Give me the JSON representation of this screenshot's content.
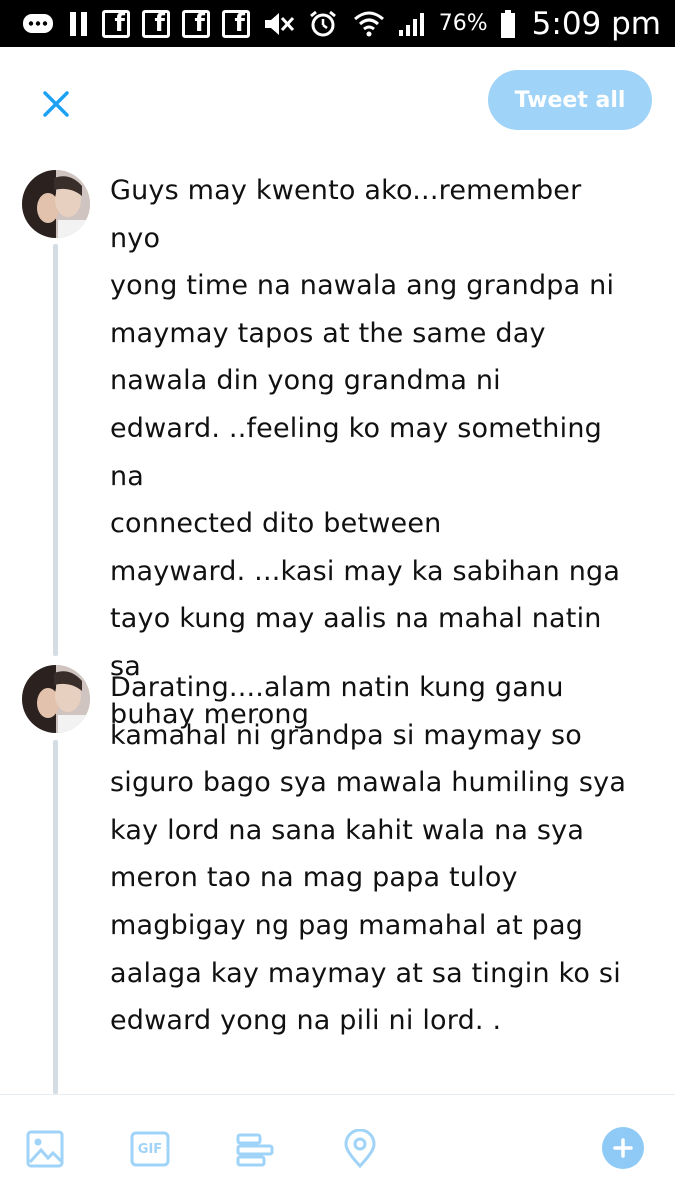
{
  "status_bar": {
    "icons": [
      "messenger-icon",
      "pause-icon",
      "facebook-icon",
      "facebook-icon",
      "facebook-icon",
      "facebook-icon",
      "mute-icon",
      "alarm-icon",
      "wifi-icon",
      "signal-icon"
    ],
    "battery": "76%",
    "time": "5:09 pm"
  },
  "header": {
    "close_icon": "close-icon",
    "tweet_all_label": "Tweet all"
  },
  "thread": [
    {
      "avatar": "user-avatar",
      "text": "Guys may kwento ako...remember nyo\nyong time na nawala ang grandpa ni\nmaymay tapos at the same day\nnawala din yong grandma ni\nedward. ..feeling ko may something na\nconnected dito between\nmayward. ...kasi may ka sabihan nga\ntayo kung may aalis na mahal natin sa\nbuhay merong"
    },
    {
      "avatar": "user-avatar",
      "text": "Darating....alam natin kung ganu\nkamahal ni grandpa si maymay so\nsiguro bago sya mawala humiling sya\nkay lord na sana kahit wala na sya\nmeron tao na mag papa tuloy\nmagbigay ng pag mamahal at pag\naalaga kay maymay at sa tingin ko si\nedward yong na pili ni lord. ."
    }
  ],
  "toolbar": {
    "items": [
      "image-icon",
      "gif-icon",
      "poll-icon",
      "location-icon",
      "add-icon"
    ],
    "gif_label": "GIF"
  },
  "colors": {
    "accent": "#1da1f2",
    "accent_light": "#9fd3f8",
    "thread_line": "#d4dde3"
  }
}
